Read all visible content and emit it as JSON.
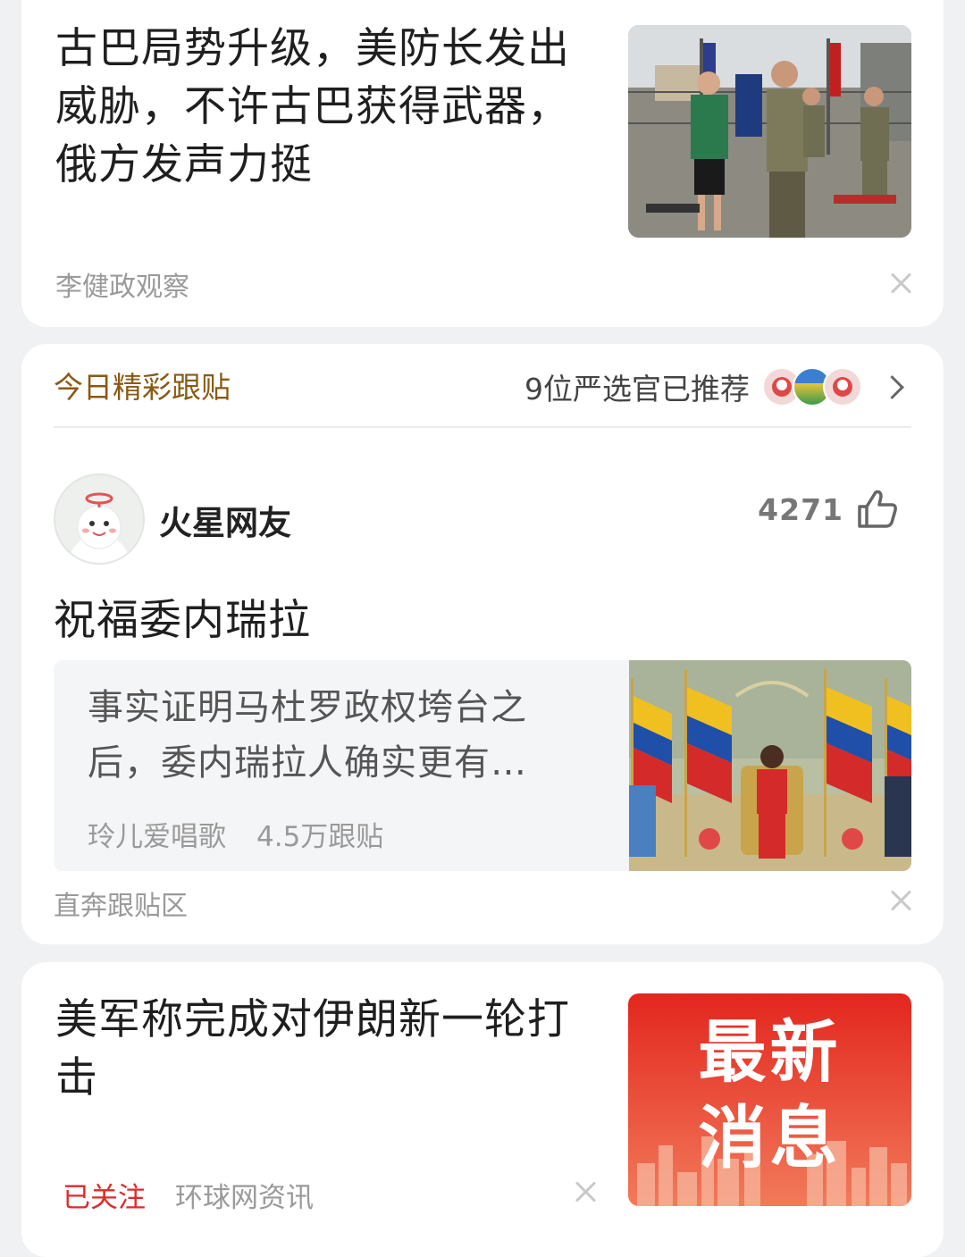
{
  "card1": {
    "headline": "古巴局势升级，美防长发出威胁，不许古巴获得武器，俄方发声力挺",
    "source": "李健政观察"
  },
  "card2": {
    "section_title": "今日精彩跟贴",
    "recommend_text": "9位严选官已推荐",
    "username": "火星网友",
    "like_count": "4271",
    "comment": "祝福委内瑞拉",
    "quoted_article": {
      "text": "事实证明马杜罗政权垮台之后，委内瑞拉人确实更有…",
      "author": "玲儿爱唱歌",
      "replies": "4.5万跟贴"
    },
    "jump_link": "直奔跟贴区"
  },
  "card3": {
    "headline": "美军称完成对伊朗新一轮打击",
    "follow_status": "已关注",
    "source": "环球网资讯",
    "thumb_line1": "最新",
    "thumb_line2": "消息"
  },
  "colors": {
    "page_bg": "#f0f1f3",
    "card_bg": "#ffffff",
    "section_title": "#8a5a14",
    "followed_red": "#e02a2a",
    "news_red": "#d8201c"
  },
  "icons": [
    "close-icon",
    "chevron-right-icon",
    "thumbs-up-icon",
    "avatar-icon"
  ]
}
